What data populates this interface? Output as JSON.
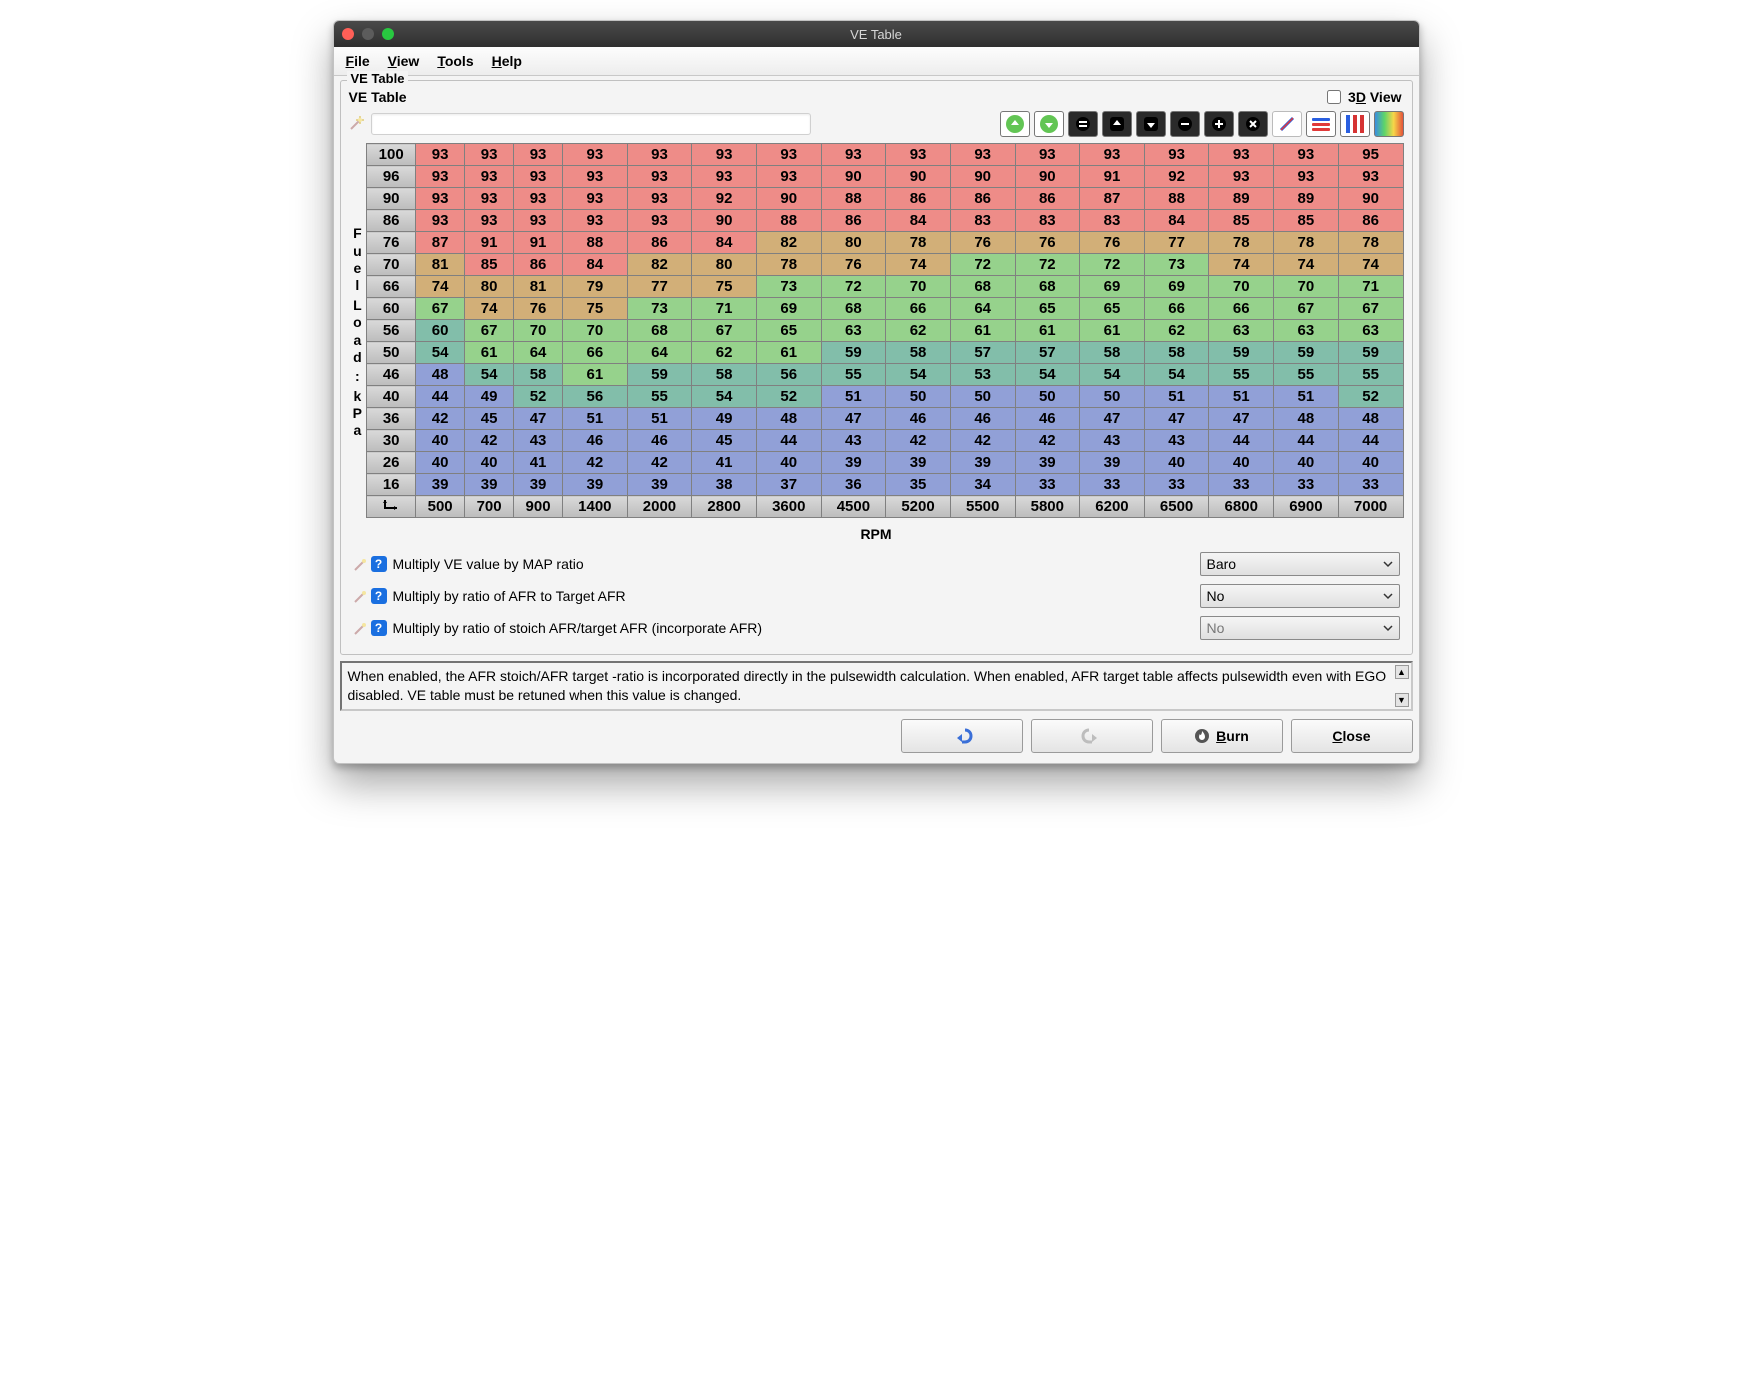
{
  "window": {
    "title": "VE Table"
  },
  "menu": {
    "file": "File",
    "view": "View",
    "tools": "Tools",
    "help": "Help"
  },
  "panel": {
    "legend": "VE Table",
    "subtitle": "VE Table",
    "view3d_label": "3D View"
  },
  "axes": {
    "y_label_chars": [
      "F",
      "u",
      "e",
      "l",
      " ",
      "L",
      "o",
      "a",
      "d",
      " ",
      ":",
      " ",
      "k",
      "P",
      "a"
    ],
    "x_label": "RPM"
  },
  "chart_data": {
    "type": "heatmap",
    "xlabel": "RPM",
    "ylabel": "Fuel Load : kPa",
    "x": [
      500,
      700,
      900,
      1400,
      2000,
      2800,
      3600,
      4500,
      5200,
      5500,
      5800,
      6200,
      6500,
      6800,
      6900,
      7000
    ],
    "y": [
      100,
      96,
      90,
      86,
      76,
      70,
      66,
      60,
      56,
      50,
      46,
      40,
      36,
      30,
      26,
      16
    ],
    "grid": [
      [
        93,
        93,
        93,
        93,
        93,
        93,
        93,
        93,
        93,
        93,
        93,
        93,
        93,
        93,
        93,
        95
      ],
      [
        93,
        93,
        93,
        93,
        93,
        93,
        93,
        90,
        90,
        90,
        90,
        91,
        92,
        93,
        93,
        93
      ],
      [
        93,
        93,
        93,
        93,
        93,
        92,
        90,
        88,
        86,
        86,
        86,
        87,
        88,
        89,
        89,
        90
      ],
      [
        93,
        93,
        93,
        93,
        93,
        90,
        88,
        86,
        84,
        83,
        83,
        83,
        84,
        85,
        85,
        86
      ],
      [
        87,
        91,
        91,
        88,
        86,
        84,
        82,
        80,
        78,
        76,
        76,
        76,
        77,
        78,
        78,
        78
      ],
      [
        81,
        85,
        86,
        84,
        82,
        80,
        78,
        76,
        74,
        72,
        72,
        72,
        73,
        74,
        74,
        74
      ],
      [
        74,
        80,
        81,
        79,
        77,
        75,
        73,
        72,
        70,
        68,
        68,
        69,
        69,
        70,
        70,
        71
      ],
      [
        67,
        74,
        76,
        75,
        73,
        71,
        69,
        68,
        66,
        64,
        65,
        65,
        66,
        66,
        67,
        67
      ],
      [
        60,
        67,
        70,
        70,
        68,
        67,
        65,
        63,
        62,
        61,
        61,
        61,
        62,
        63,
        63,
        63
      ],
      [
        54,
        61,
        64,
        66,
        64,
        62,
        61,
        59,
        58,
        57,
        57,
        58,
        58,
        59,
        59,
        59
      ],
      [
        48,
        54,
        58,
        61,
        59,
        58,
        56,
        55,
        54,
        53,
        54,
        54,
        54,
        55,
        55,
        55
      ],
      [
        44,
        49,
        52,
        56,
        55,
        54,
        52,
        51,
        50,
        50,
        50,
        50,
        51,
        51,
        51,
        52
      ],
      [
        42,
        45,
        47,
        51,
        51,
        49,
        48,
        47,
        46,
        46,
        46,
        47,
        47,
        47,
        48,
        48
      ],
      [
        40,
        42,
        43,
        46,
        46,
        45,
        44,
        43,
        42,
        42,
        42,
        43,
        43,
        44,
        44,
        44
      ],
      [
        40,
        40,
        41,
        42,
        42,
        41,
        40,
        39,
        39,
        39,
        39,
        39,
        40,
        40,
        40,
        40
      ],
      [
        39,
        39,
        39,
        39,
        39,
        38,
        37,
        36,
        35,
        34,
        33,
        33,
        33,
        33,
        33,
        33
      ]
    ],
    "value_range": [
      30,
      100
    ]
  },
  "options": [
    {
      "label": "Multiply VE value by MAP ratio",
      "value": "Baro",
      "enabled": true
    },
    {
      "label": "Multiply by ratio of AFR to Target AFR",
      "value": "No",
      "enabled": true
    },
    {
      "label": "Multiply by ratio of stoich AFR/target AFR (incorporate AFR)",
      "value": "No",
      "enabled": false
    }
  ],
  "info_text": "When enabled, the AFR stoich/AFR target -ratio is incorporated directly in the pulsewidth calculation. When enabled, AFR target table affects pulsewidth even with EGO disabled. VE table must be retuned when this value is changed.",
  "buttons": {
    "burn": "Burn",
    "close": "Close"
  }
}
